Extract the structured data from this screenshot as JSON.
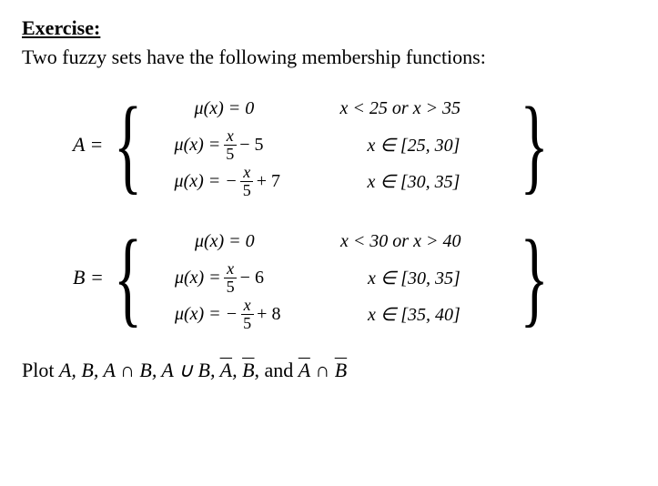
{
  "heading": "Exercise:",
  "intro": "Two fuzzy sets have the following membership functions:",
  "sets": {
    "A": {
      "label": "A = ",
      "rows": [
        {
          "mu_pre": "μ(x) = 0",
          "frac_num": "",
          "frac_den": "",
          "mu_post": "",
          "cond_pre": "x < 25  or  x > 35"
        },
        {
          "mu_pre": "μ(x) = ",
          "frac_num": "x",
          "frac_den": "5",
          "mu_post": " − 5",
          "cond_pre": "x ∈ [25, 30]"
        },
        {
          "mu_pre": "μ(x) = −",
          "frac_num": "x",
          "frac_den": "5",
          "mu_post": " + 7",
          "cond_pre": "x ∈ [30, 35]"
        }
      ]
    },
    "B": {
      "label": "B = ",
      "rows": [
        {
          "mu_pre": "μ(x) = 0",
          "frac_num": "",
          "frac_den": "",
          "mu_post": "",
          "cond_pre": "x < 30  or  x > 40"
        },
        {
          "mu_pre": "μ(x) = ",
          "frac_num": "x",
          "frac_den": "5",
          "mu_post": " − 6",
          "cond_pre": "x ∈ [30, 35]"
        },
        {
          "mu_pre": "μ(x) = −",
          "frac_num": "x",
          "frac_den": "5",
          "mu_post": " + 8",
          "cond_pre": "x ∈ [35, 40]"
        }
      ]
    }
  },
  "outro_pre": "Plot ",
  "outro_math": "A, B, A ∩ B, A ∪ B, ",
  "outro_abar": "A",
  "outro_comma1": ", ",
  "outro_bbar": "B",
  "outro_comma2": ", and ",
  "outro_abar2": "A",
  "outro_inter": " ∩ ",
  "outro_bbar2": "B"
}
